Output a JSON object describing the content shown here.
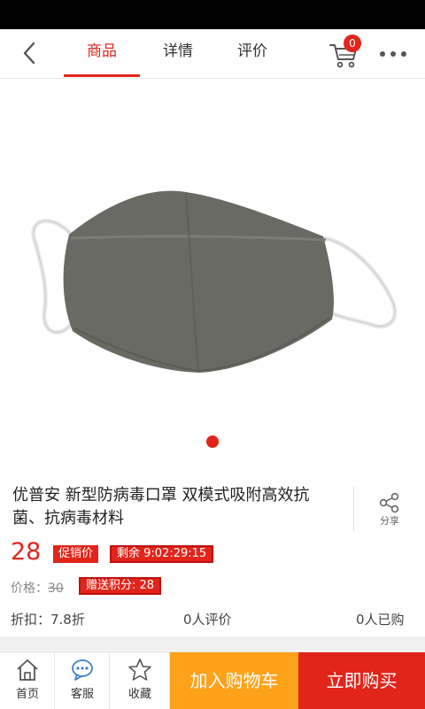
{
  "nav": {
    "tabs": [
      {
        "label": "商品",
        "active": true
      },
      {
        "label": "详情",
        "active": false
      },
      {
        "label": "评价",
        "active": false
      }
    ],
    "cart_count": "0",
    "accent_color": "#e1251b"
  },
  "product": {
    "title": "优普安 新型防病毒口罩 双模式吸附高效抗菌、抗病毒材料",
    "price": "28",
    "promo_tag": "促销价",
    "countdown_tag": "剩余  9:02:29:15",
    "orig_price_label": "价格：",
    "orig_price_value": "30",
    "points_tag": "赠送积分: 28",
    "discount": "折扣：7.8折",
    "reviews": "0人评价",
    "sold": "0人已购",
    "share_label": "分享"
  },
  "bottom": {
    "home": "首页",
    "service": "客服",
    "favorite": "收藏",
    "add_to_cart": "加入购物车",
    "buy_now": "立即购买",
    "add_cart_color": "#ffa21a",
    "buy_color": "#e1251b"
  }
}
